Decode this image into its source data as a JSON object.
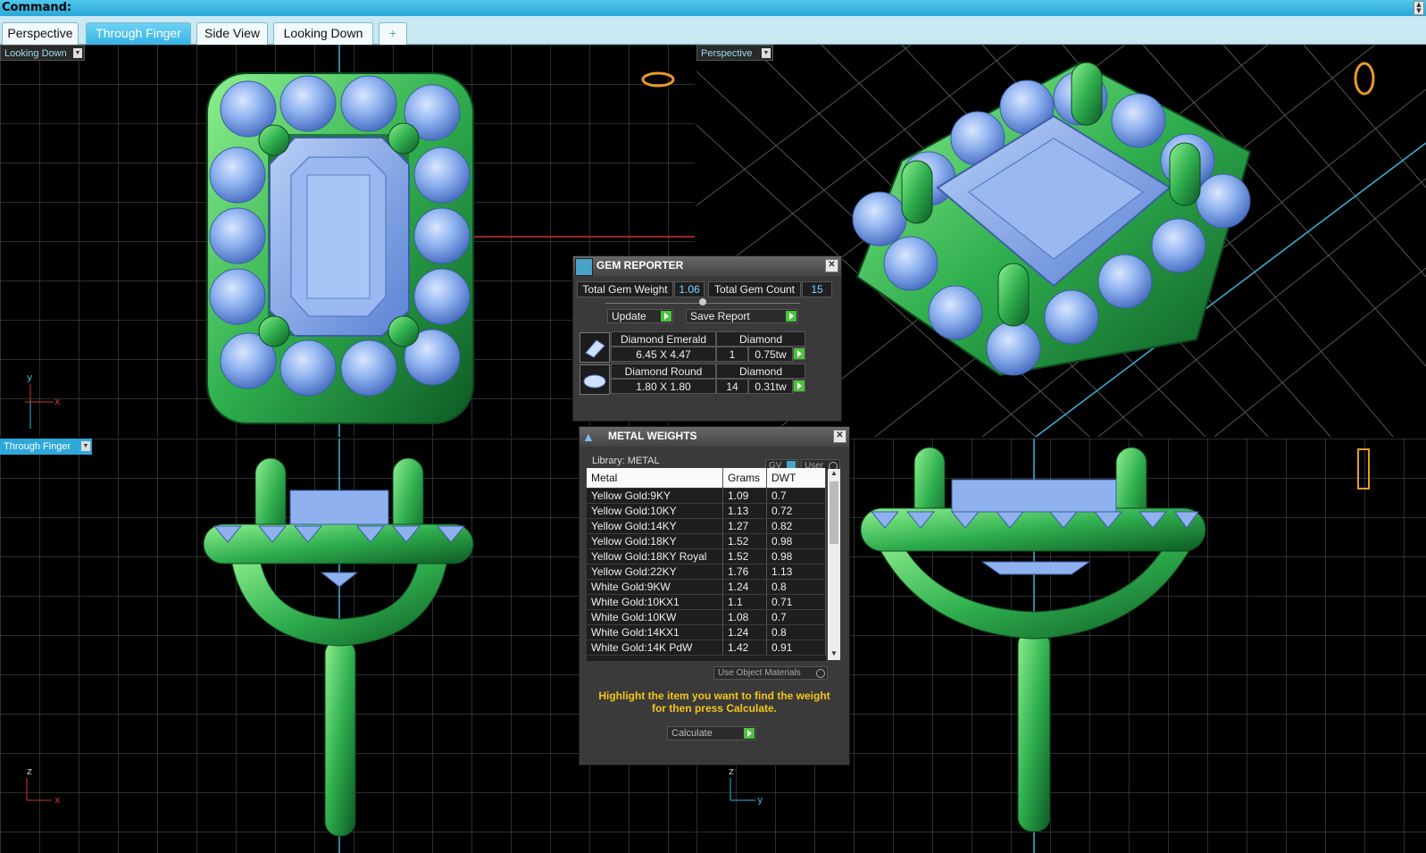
{
  "command": {
    "label": "Command:"
  },
  "tabs": [
    {
      "label": "Perspective"
    },
    {
      "label": "Through Finger"
    },
    {
      "label": "Side View"
    },
    {
      "label": "Looking Down"
    },
    {
      "label": "+"
    }
  ],
  "viewports": {
    "top_left": "Looking Down",
    "top_right": "Perspective",
    "bottom_left": "Through Finger"
  },
  "axes": {
    "top_left": {
      "v": "y",
      "h": "x"
    },
    "bottom_left": {
      "v": "z",
      "h": "x"
    },
    "bottom_right": {
      "v": "z",
      "h": "y"
    }
  },
  "gem_reporter": {
    "title": "GEM REPORTER",
    "total_weight_label": "Total Gem Weight",
    "total_weight": "1.06",
    "total_count_label": "Total Gem Count",
    "total_count": "15",
    "update": "Update",
    "save_report": "Save Report",
    "gems": [
      {
        "name": "Diamond Emerald",
        "material": "Diamond",
        "size": "6.45 X 4.47",
        "count": "1",
        "weight": "0.75tw"
      },
      {
        "name": "Diamond Round",
        "material": "Diamond",
        "size": "1.80 X 1.80",
        "count": "14",
        "weight": "0.31tw"
      }
    ]
  },
  "metal_weights": {
    "title": "METAL WEIGHTS",
    "library": "Library: METAL",
    "gv": "GV",
    "user": "User",
    "headers": [
      "Metal",
      "Grams",
      "DWT"
    ],
    "rows": [
      [
        "Yellow Gold:9KY",
        "1.09",
        "0.7"
      ],
      [
        "Yellow Gold:10KY",
        "1.13",
        "0.72"
      ],
      [
        "Yellow Gold:14KY",
        "1.27",
        "0.82"
      ],
      [
        "Yellow Gold:18KY",
        "1.52",
        "0.98"
      ],
      [
        "Yellow Gold:18KY Royal",
        "1.52",
        "0.98"
      ],
      [
        "Yellow Gold:22KY",
        "1.76",
        "1.13"
      ],
      [
        "White Gold:9KW",
        "1.24",
        "0.8"
      ],
      [
        "White Gold:10KX1",
        "1.1",
        "0.71"
      ],
      [
        "White Gold:10KW",
        "1.08",
        "0.7"
      ],
      [
        "White Gold:14KX1",
        "1.24",
        "0.8"
      ],
      [
        "White Gold:14K PdW",
        "1.42",
        "0.91"
      ]
    ],
    "use_object_materials": "Use Object Materials",
    "instruction": "Highlight the item you want to find the weight for then press Calculate.",
    "calculate": "Calculate"
  },
  "colors": {
    "metal": "#2fae4e",
    "gem": "#7fa6ea",
    "accent": "#2ea8d9",
    "instruction": "#f5c518"
  }
}
